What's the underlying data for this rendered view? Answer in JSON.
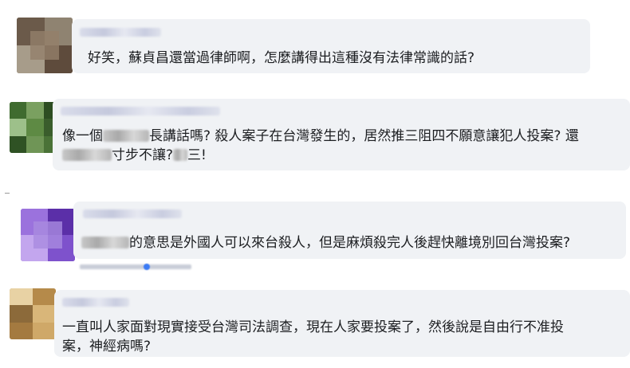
{
  "comments": [
    {
      "text": "好笑，蘇貞昌還當過律師啊，怎麼講得出這種沒有法律常識的話?",
      "avatar_colors": [
        "#6b5a4a",
        "#8a7a66",
        "#a7a090",
        "#5e4b3c"
      ]
    },
    {
      "line1_pre": "像一個",
      "line1_mid": "長講話嗎? 殺人案子在台灣發生的，居然推三阻四不願意讓犯人投案? 還",
      "line2_mid": "寸步不讓?",
      "line2_end": "三!",
      "avatar_colors": [
        "#3f6b2f",
        "#7aa060",
        "#2d4d22",
        "#9dc08a"
      ]
    },
    {
      "text_end": "的意思是外國人可以來台殺人，但是麻煩殺完人後趕快離境別回台灣投案?",
      "avatar_colors": [
        "#7a4cc6",
        "#9b72dd",
        "#5b2fa8",
        "#c3a6ee"
      ]
    },
    {
      "line1": "一直叫人家面對現實接受台灣司法調查，現在人家要投案了，然後說是自由行不准投",
      "line2": "案，神經病嗎?",
      "avatar_colors": [
        "#b58a4a",
        "#d9b679",
        "#8c6a3a",
        "#e8d2a4"
      ]
    }
  ]
}
